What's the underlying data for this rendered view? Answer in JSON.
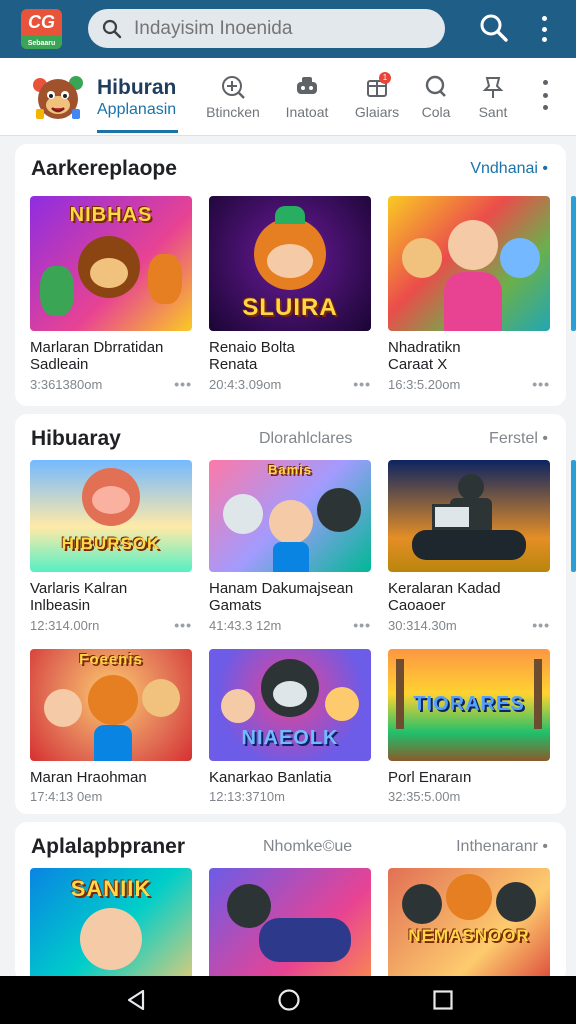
{
  "appbar": {
    "logo_mark": "CG",
    "logo_word": "Sebaaru",
    "search_placeholder": "Indayisim Inoenida",
    "search_icon": "search-icon",
    "menu_icon": "more-vert-icon"
  },
  "category": {
    "title": "Hiburan",
    "subtitle": "Applanasin"
  },
  "tabs": [
    {
      "label": "Btincken",
      "icon": "add-circle-icon"
    },
    {
      "label": "Inatoat",
      "icon": "game-controller-icon"
    },
    {
      "label": "Glaiars",
      "icon": "gift-icon",
      "badge": "1"
    },
    {
      "label": "Cola",
      "icon": "search-icon"
    },
    {
      "label": "Sant",
      "icon": "pin-icon"
    }
  ],
  "sections": [
    {
      "title": "Aarkereplaope",
      "mid": "",
      "link": "Vndhanai •",
      "cards": [
        {
          "title": "Marlaran Dbrratidan\nSadleain",
          "meta": "3:361380om",
          "thumb_text": "NIBHAS"
        },
        {
          "title": "Renaio Bolta\nRenata",
          "meta": "20:4:3.09om",
          "thumb_text": "SLUIRA"
        },
        {
          "title": "Nhadratikn\nCaraat X",
          "meta": "16:3:5.20om",
          "thumb_text": ""
        }
      ]
    },
    {
      "title": "Hibuaray",
      "mid": "Dlorahlclares",
      "link": "Ferstel •",
      "cards": [
        {
          "title": "Varlaris Kalran\nInlbeasin",
          "meta": "12:314.00rn",
          "thumb_text": "HIBURSOK"
        },
        {
          "title": "Hanam Dakumajsean\nGamats",
          "meta": "41:43.3 12m",
          "thumb_text": "Bamis"
        },
        {
          "title": "Keralaran Kadad\nCaoaoer",
          "meta": "30:314.30m",
          "thumb_text": ""
        },
        {
          "title": "Maran Hraohman",
          "meta": "17:4:13 0em",
          "thumb_text": "Foeenis"
        },
        {
          "title": "Kanarkao Banlatia",
          "meta": "12:13:3710m",
          "thumb_text": "NIAEOLK"
        },
        {
          "title": "Porl Enaraın",
          "meta": "32:35:5.00m",
          "thumb_text": "TIORARES"
        }
      ]
    },
    {
      "title": "Aplalapbpraner",
      "mid": "Nhomke©ue",
      "link": "Inthenaranr •",
      "cards": [
        {
          "title": "",
          "meta": "",
          "thumb_text": "SANIIK"
        },
        {
          "title": "",
          "meta": "",
          "thumb_text": ""
        },
        {
          "title": "",
          "meta": "",
          "thumb_text": "NEMASNOOR"
        }
      ]
    }
  ],
  "card_more": "•••",
  "navbar": {
    "back_icon": "back-triangle-icon",
    "home_icon": "home-circle-icon",
    "recents_icon": "recents-square-icon"
  },
  "colors": {
    "appbar": "#1f5e86",
    "accent": "#1a73a8",
    "background": "#f1f3f4"
  }
}
